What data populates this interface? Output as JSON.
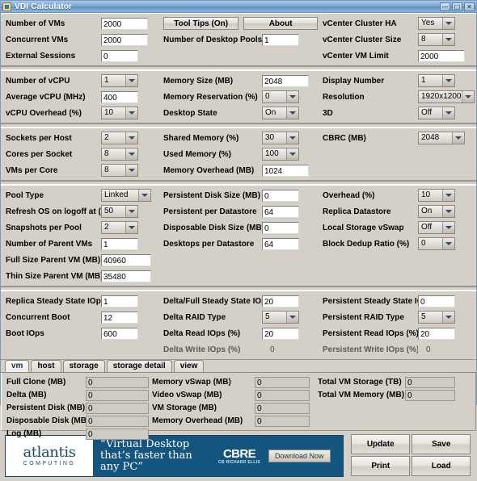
{
  "window": {
    "title": "VDI Calculator",
    "icon": "app-icon",
    "buttons": {
      "minimize": "_",
      "maximize": "❐",
      "close": "✕"
    }
  },
  "toolbar": {
    "tooltips_label": "Tool Tips (On)",
    "about_label": "About"
  },
  "groups": [
    {
      "name": "sizing",
      "rows": [
        {
          "c1": {
            "label": "Number of VMs",
            "type": "text",
            "value": "2000"
          },
          "c2": {
            "label": "",
            "type": "button",
            "value": "Tool Tips (On)"
          },
          "c3": {
            "label": "vCenter Cluster HA",
            "type": "select",
            "value": "Yes"
          }
        },
        {
          "c1": {
            "label": "Concurrent VMs",
            "type": "text",
            "value": "2000"
          },
          "c2": {
            "label": "Number of Desktop Pools",
            "type": "text",
            "value": "1"
          },
          "c3": {
            "label": "vCenter Cluster Size",
            "type": "select",
            "value": "8"
          }
        },
        {
          "c1": {
            "label": "External Sessions",
            "type": "text",
            "value": "0"
          },
          "c2": {
            "label": "",
            "type": "none",
            "value": ""
          },
          "c3": {
            "label": "vCenter VM Limit",
            "type": "text",
            "value": "2000"
          }
        }
      ]
    },
    {
      "name": "cpu-memory",
      "rows": [
        {
          "c1": {
            "label": "Number of vCPU",
            "type": "select",
            "value": "1"
          },
          "c2": {
            "label": "Memory Size (MB)",
            "type": "text",
            "value": "2048"
          },
          "c3": {
            "label": "Display Number",
            "type": "select",
            "value": "1"
          }
        },
        {
          "c1": {
            "label": "Average vCPU (MHz)",
            "type": "text",
            "value": "400"
          },
          "c2": {
            "label": "Memory Reservation (%)",
            "type": "select",
            "value": "0"
          },
          "c3": {
            "label": "Resolution",
            "type": "select",
            "value": "1920x1200"
          }
        },
        {
          "c1": {
            "label": "vCPU Overhead (%)",
            "type": "select",
            "value": "10"
          },
          "c2": {
            "label": "Desktop State",
            "type": "select",
            "value": "On"
          },
          "c3": {
            "label": "3D",
            "type": "select",
            "value": "Off"
          }
        }
      ]
    },
    {
      "name": "host-memory",
      "rows": [
        {
          "c1": {
            "label": "Sockets per Host",
            "type": "select",
            "value": "2"
          },
          "c2": {
            "label": "Shared Memory (%)",
            "type": "select",
            "value": "30"
          },
          "c3": {
            "label": "CBRC (MB)",
            "type": "select",
            "value": "2048"
          }
        },
        {
          "c1": {
            "label": "Cores per Socket",
            "type": "select",
            "value": "8"
          },
          "c2": {
            "label": "Used Memory (%)",
            "type": "select",
            "value": "100"
          },
          "c3": {
            "label": "",
            "type": "none",
            "value": ""
          }
        },
        {
          "c1": {
            "label": "VMs per Core",
            "type": "select",
            "value": "8"
          },
          "c2": {
            "label": "Memory Overhead (MB)",
            "type": "text",
            "value": "1024"
          },
          "c3": {
            "label": "",
            "type": "none",
            "value": ""
          }
        }
      ]
    },
    {
      "name": "pool-storage",
      "rows": [
        {
          "c1": {
            "label": "Pool Type",
            "type": "select",
            "value": "Linked"
          },
          "c2": {
            "label": "Persistent Disk Size (MB)",
            "type": "text",
            "value": "0"
          },
          "c3": {
            "label": "Overhead (%)",
            "type": "select",
            "value": "10"
          }
        },
        {
          "c1": {
            "label": "Refresh OS on logoff at (%)",
            "type": "select",
            "value": "50"
          },
          "c2": {
            "label": "Persistent per Datastore",
            "type": "text",
            "value": "64"
          },
          "c3": {
            "label": "Replica Datastore",
            "type": "select",
            "value": "On"
          }
        },
        {
          "c1": {
            "label": "Snapshots per Pool",
            "type": "select",
            "value": "2"
          },
          "c2": {
            "label": "Disposable Disk Size (MB)",
            "type": "text",
            "value": "0"
          },
          "c3": {
            "label": "Local Storage vSwap",
            "type": "select",
            "value": "Off"
          }
        },
        {
          "c1": {
            "label": "Number of Parent VMs",
            "type": "text",
            "value": "1"
          },
          "c2": {
            "label": "Desktops per Datastore",
            "type": "text",
            "value": "64"
          },
          "c3": {
            "label": "Block Dedup Ratio (%)",
            "type": "select",
            "value": "0"
          }
        },
        {
          "c1": {
            "label": "Full Size Parent VM (MB)",
            "type": "text",
            "value": "40960"
          },
          "c2": {
            "label": "",
            "type": "none",
            "value": ""
          },
          "c3": {
            "label": "",
            "type": "none",
            "value": ""
          }
        },
        {
          "c1": {
            "label": "Thin Size Parent VM (MB)",
            "type": "text",
            "value": "35480"
          },
          "c2": {
            "label": "",
            "type": "none",
            "value": ""
          },
          "c3": {
            "label": "",
            "type": "none",
            "value": ""
          }
        }
      ]
    },
    {
      "name": "iops",
      "rows": [
        {
          "c1": {
            "label": "Replica Steady State IOps",
            "type": "text",
            "value": "1"
          },
          "c2": {
            "label": "Delta/Full Steady State IOps",
            "type": "text",
            "value": "20"
          },
          "c3": {
            "label": "Persistent Steady State IOps",
            "type": "text",
            "value": "0"
          }
        },
        {
          "c1": {
            "label": "Concurrent Boot",
            "type": "text",
            "value": "12"
          },
          "c2": {
            "label": "Delta RAID Type",
            "type": "select",
            "value": "5"
          },
          "c3": {
            "label": "Persistent RAID Type",
            "type": "select",
            "value": "5"
          }
        },
        {
          "c1": {
            "label": "Boot IOps",
            "type": "text",
            "value": "600"
          },
          "c2": {
            "label": "Delta Read IOps (%)",
            "type": "text",
            "value": "20"
          },
          "c3": {
            "label": "Persistent Read IOps (%)",
            "type": "text",
            "value": "20"
          }
        },
        {
          "c1": {
            "label": "",
            "type": "none",
            "value": ""
          },
          "c2": {
            "label": "Delta Write IOps (%)",
            "type": "static",
            "value": "0"
          },
          "c3": {
            "label": "Persistent Write IOps (%)",
            "type": "static",
            "value": "0"
          }
        }
      ]
    }
  ],
  "tabs": [
    {
      "label": "vm",
      "active": true
    },
    {
      "label": "host",
      "active": false
    },
    {
      "label": "storage",
      "active": false
    },
    {
      "label": "storage detail",
      "active": false
    },
    {
      "label": "view",
      "active": false
    }
  ],
  "results": {
    "group1": [
      {
        "label": "Full Clone (MB)",
        "value": "0"
      },
      {
        "label": "Delta (MB)",
        "value": "0"
      },
      {
        "label": "Persistent Disk (MB)",
        "value": "0"
      },
      {
        "label": "Disposable Disk (MB)",
        "value": "0"
      },
      {
        "label": "Log (MB)",
        "value": "0"
      }
    ],
    "group2": [
      {
        "label": "Memory vSwap (MB)",
        "value": "0"
      },
      {
        "label": "Video vSwap (MB)",
        "value": "0"
      },
      {
        "label": "VM Storage (MB)",
        "value": "0"
      },
      {
        "label": "Memory Overhead (MB)",
        "value": "0"
      }
    ],
    "group3": [
      {
        "label": "Total VM Storage (TB)",
        "value": "0"
      },
      {
        "label": "Total VM Memory (MB)",
        "value": "0"
      }
    ]
  },
  "footer": {
    "brand_name": "atlantis",
    "brand_sub": "COMPUTING",
    "slogan": "“Virtual Desktop that’s faster than any PC”",
    "partner_name": "CBRE",
    "partner_sub": "CB RICHARD ELLIS",
    "download_label": "Download Now",
    "actions": [
      "Update",
      "Save",
      "Print",
      "Load"
    ],
    "banner_color": "#14557f"
  }
}
